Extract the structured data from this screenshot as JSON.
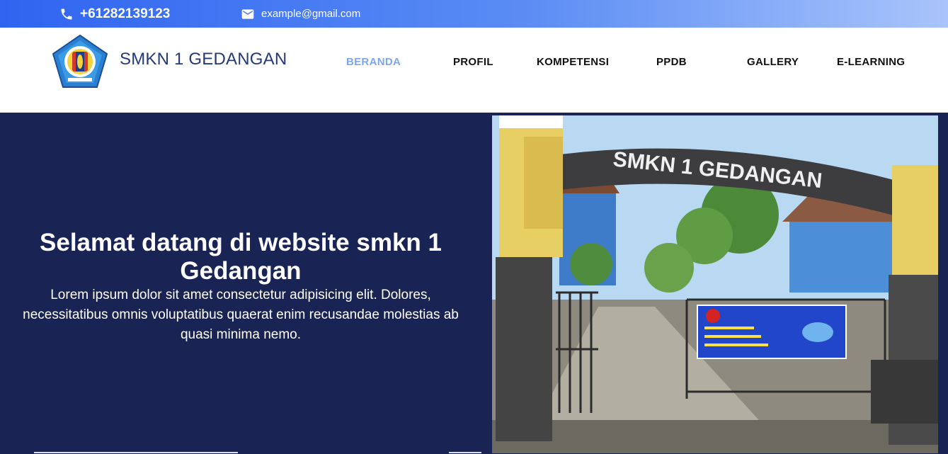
{
  "topbar": {
    "phone_icon": "phone-icon",
    "phone": "+61282139123",
    "email_icon": "mail-icon",
    "email": "example@gmail.com"
  },
  "header": {
    "logo_icon": "school-emblem-logo",
    "brand": "SMKN 1 GEDANGAN",
    "nav": [
      {
        "label": "BERANDA",
        "active": true
      },
      {
        "label": "PROFIL",
        "active": false
      },
      {
        "label": "KOMPETENSI",
        "active": false
      },
      {
        "label": "PPDB",
        "active": false
      },
      {
        "label": "GALLERY",
        "active": false
      },
      {
        "label": "E-LEARNING",
        "active": false
      }
    ]
  },
  "hero": {
    "title": "Selamat datang di website smkn 1 Gedangan",
    "text": "Lorem ipsum dolor sit amet consectetur adipisicing elit. Dolores, necessitatibus omnis voluptatibus quaerat enim recusandae molestias ab quasi minima nemo.",
    "photo_sign": "SMKN 1 GEDANGAN"
  },
  "colors": {
    "topbar_start": "#2f64f0",
    "topbar_end": "#a9c4fb",
    "hero_bg": "#1a2454",
    "brand": "#253a78",
    "nav_active": "#7ea6ee"
  }
}
